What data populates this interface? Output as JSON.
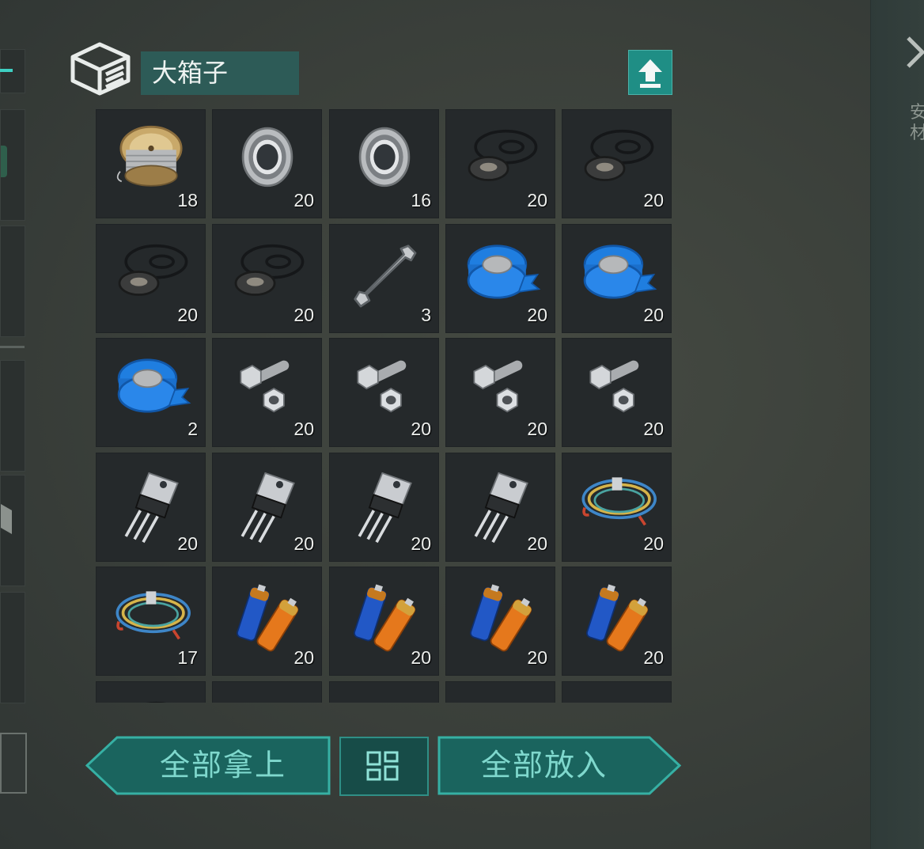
{
  "container": {
    "title": "大箱子",
    "icon": "box-stack-icon"
  },
  "buttons": {
    "take_all": "全部拿上",
    "put_all": "全部放入",
    "sort": "grid-sort-icon",
    "upload": "upload-arrow-icon",
    "close": "close-icon"
  },
  "side_text": "安\n材",
  "accent_color": "#3ecfc2",
  "slots": [
    {
      "item": "wire-spool",
      "qty": "18"
    },
    {
      "item": "bearing",
      "qty": "20"
    },
    {
      "item": "bearing",
      "qty": "16"
    },
    {
      "item": "gasket-set",
      "qty": "20"
    },
    {
      "item": "gasket-set",
      "qty": "20"
    },
    {
      "item": "gasket-set",
      "qty": "20"
    },
    {
      "item": "gasket-set",
      "qty": "20"
    },
    {
      "item": "wrench",
      "qty": "3"
    },
    {
      "item": "blue-tape",
      "qty": "20"
    },
    {
      "item": "blue-tape",
      "qty": "20"
    },
    {
      "item": "blue-tape",
      "qty": "2"
    },
    {
      "item": "bolt-nut",
      "qty": "20"
    },
    {
      "item": "bolt-nut",
      "qty": "20"
    },
    {
      "item": "bolt-nut",
      "qty": "20"
    },
    {
      "item": "bolt-nut",
      "qty": "20"
    },
    {
      "item": "transistor",
      "qty": "20"
    },
    {
      "item": "transistor",
      "qty": "20"
    },
    {
      "item": "transistor",
      "qty": "20"
    },
    {
      "item": "transistor",
      "qty": "20"
    },
    {
      "item": "wire-bundle",
      "qty": "20"
    },
    {
      "item": "wire-bundle",
      "qty": "17"
    },
    {
      "item": "batteries",
      "qty": "20"
    },
    {
      "item": "batteries",
      "qty": "20"
    },
    {
      "item": "batteries",
      "qty": "20"
    },
    {
      "item": "batteries",
      "qty": "20"
    },
    {
      "item": "gasket-set",
      "qty": ""
    },
    {
      "item": "empty",
      "qty": ""
    },
    {
      "item": "empty",
      "qty": ""
    },
    {
      "item": "empty",
      "qty": ""
    },
    {
      "item": "empty",
      "qty": ""
    }
  ]
}
